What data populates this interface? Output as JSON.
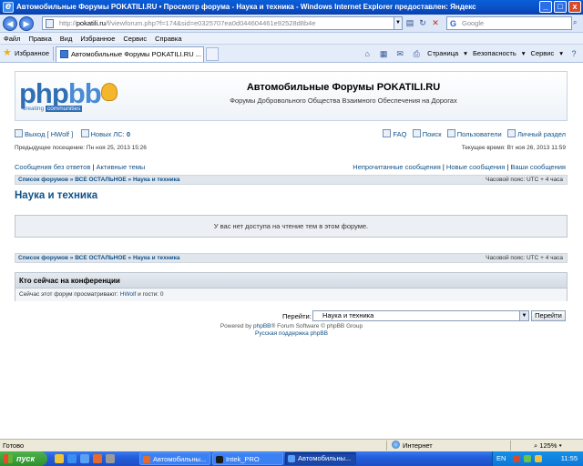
{
  "window": {
    "title": "Автомобильные Форумы POKATILI.RU • Просмотр форума - Наука и техника - Windows Internet Explorer предоставлен: Яндекс",
    "buttons": {
      "minimize": "_",
      "maximize": "□",
      "close": "x"
    }
  },
  "address_bar": {
    "url_prefix": "http://",
    "url_domain": "pokatili.ru",
    "url_rest": "/f/viewforum.php?f=174&sid=e0325707ea0d044604461e92528d8b4e",
    "search_placeholder": "Google"
  },
  "menu": [
    "Файл",
    "Правка",
    "Вид",
    "Избранное",
    "Сервис",
    "Справка"
  ],
  "favorites": {
    "label": "Избранное",
    "tab_label": "Автомобильные Форумы POKATILI.RU ...",
    "commands": {
      "page": "Страница",
      "security": "Безопасность",
      "tools": "Сервис"
    }
  },
  "header": {
    "logo_text_php": "php",
    "logo_text_bb": "bb",
    "logo_sub_a": "creating",
    "logo_sub_b": "communities",
    "site_title": "Автомобильные Форумы POKATILI.RU",
    "site_description": "Форумы Добровольного Общества Взаимного Обеспечения на Дорогах"
  },
  "user_bar": {
    "logout_prefix": "Выход [",
    "username": "HWolf",
    "logout_suffix": "]",
    "new_pm_label": "Новых ЛС:",
    "new_pm_count": "0",
    "faq": "FAQ",
    "search": "Поиск",
    "members": "Пользователи",
    "ucp": "Личный раздел"
  },
  "visits": {
    "last_visit": "Предыдущее посещение: Пн ноя 25, 2013 15:26",
    "current_time": "Текущее время: Вт ноя 26, 2013 11:59"
  },
  "quick_links": {
    "unanswered": "Сообщения без ответов",
    "separator": "|",
    "active": "Активные темы",
    "unread": "Непрочитанные сообщения",
    "new_posts": "Новые сообщения",
    "your_posts": "Ваши сообщения"
  },
  "breadcrumb": {
    "index": "Список форумов",
    "sep": "»",
    "category": "ВСЕ ОСТАЛЬНОЕ",
    "forum": "Наука и техника",
    "timezone": "Часовой пояс: UTC + 4 часа"
  },
  "forum_title": "Наука и техника",
  "notice": "У вас нет доступа на чтение тем в этом форуме.",
  "online": {
    "heading": "Кто сейчас на конференции",
    "text_prefix": "Сейчас этот форум просматривают:",
    "user": "HWolf",
    "text_suffix": "и гости: 0"
  },
  "jumpbox": {
    "label": "Перейти:",
    "selected": "Наука и техника",
    "button": "Перейти"
  },
  "footer": {
    "powered_prefix": "Powered by",
    "phpbb_link": "phpBB",
    "powered_suffix": "® Forum Software © phpBB Group",
    "support_link": "Русская поддержка phpBB"
  },
  "status_bar": {
    "text": "Готово",
    "zone": "Интернет",
    "zoom": "125%"
  },
  "taskbar": {
    "start": "пуск",
    "tasks": [
      "Автомобильны...",
      "Intek_PRO",
      "Автомобильны..."
    ],
    "lang": "EN",
    "clock": "11:55"
  }
}
